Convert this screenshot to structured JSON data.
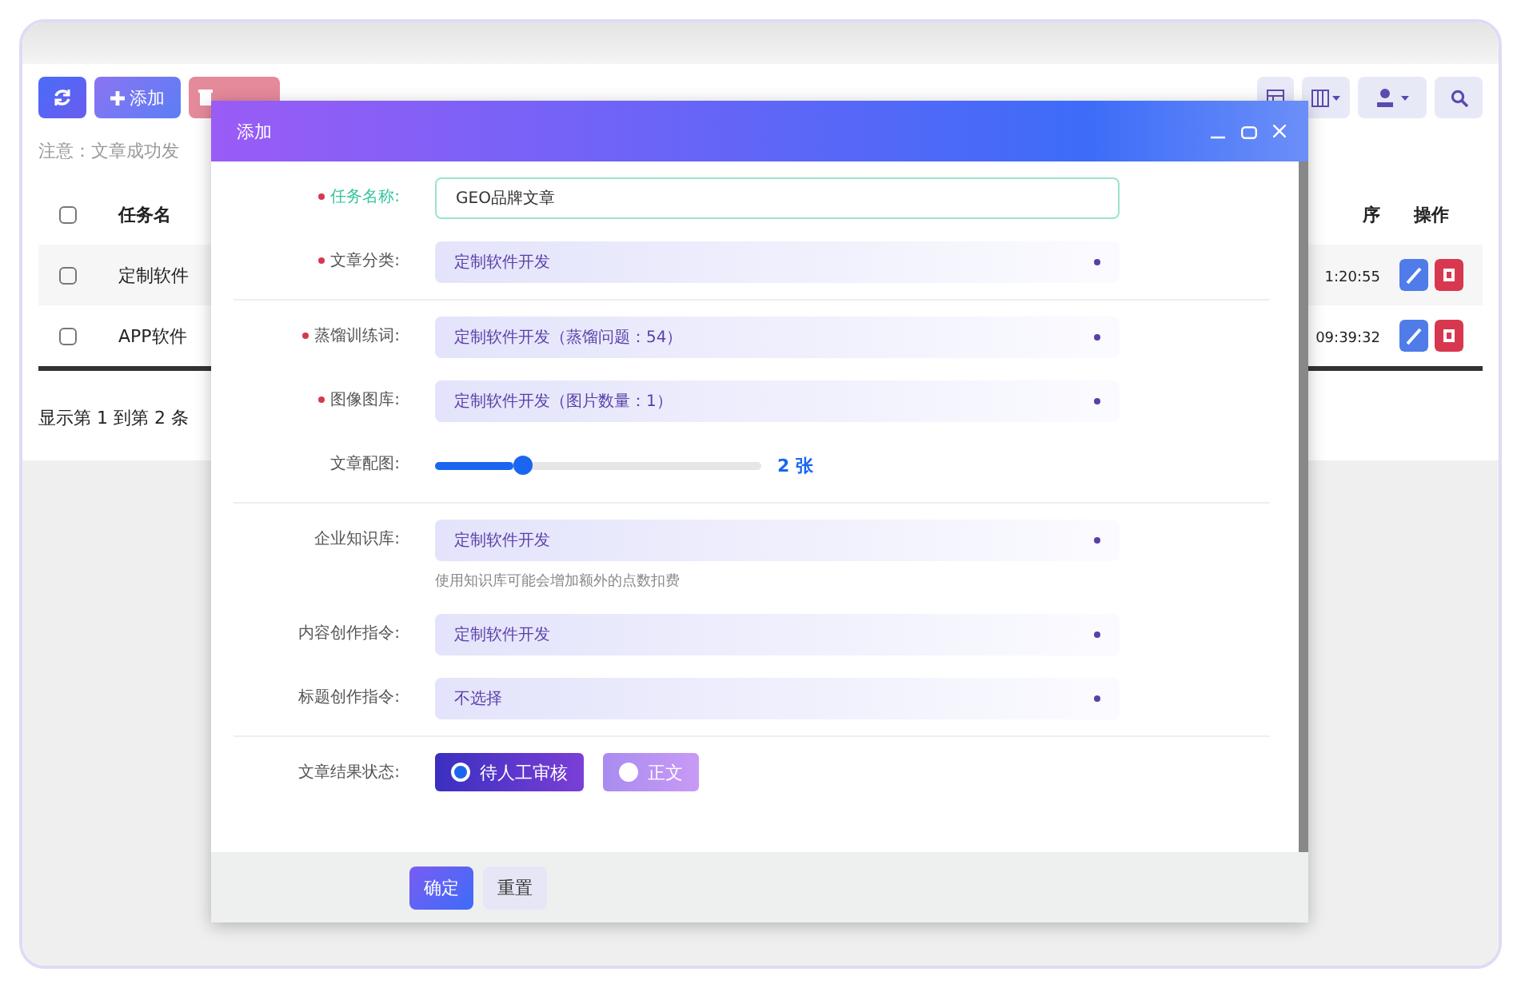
{
  "page": {
    "toolbar": {
      "add_label": "添加"
    },
    "note": "注意：文章成功发",
    "table": {
      "columns": [
        "任务名",
        "序",
        "操作"
      ],
      "header_checked": false,
      "rows": [
        {
          "name": "定制软件",
          "time": "1:20:55",
          "checked": false
        },
        {
          "name": "APP软件",
          "time": "09:39:32",
          "checked": false
        }
      ]
    },
    "footer": "显示第 1 到第 2 条"
  },
  "dialog": {
    "title": "添加",
    "groups": [
      [
        {
          "kind": "text",
          "label": "任务名称:",
          "required": true,
          "value": "GEO品牌文章"
        },
        {
          "kind": "select",
          "label": "文章分类:",
          "required": true,
          "value": "定制软件开发"
        }
      ],
      [
        {
          "kind": "select",
          "label": "蒸馏训练词:",
          "required": true,
          "value": "定制软件开发（蒸馏问题：54）"
        },
        {
          "kind": "select",
          "label": "图像图库:",
          "required": true,
          "value": "定制软件开发（图片数量：1）"
        },
        {
          "kind": "slider",
          "label": "文章配图:",
          "required": false,
          "level": 0.27,
          "reading": "2 张"
        }
      ],
      [
        {
          "kind": "select",
          "label": "企业知识库:",
          "required": false,
          "value": "定制软件开发",
          "hint": "使用知识库可能会增加额外的点数扣费"
        },
        {
          "kind": "select",
          "label": "内容创作指令:",
          "required": false,
          "value": "定制软件开发"
        },
        {
          "kind": "select",
          "label": "标题创作指令:",
          "required": false,
          "value": "不选择"
        }
      ],
      [
        {
          "kind": "radio",
          "label": "文章结果状态:",
          "required": false,
          "options": [
            {
              "label": "待人工审核",
              "selected": true
            },
            {
              "label": "正文",
              "selected": false
            }
          ]
        }
      ]
    ],
    "buttons": [
      {
        "label": "确定",
        "kind": "primary"
      },
      {
        "label": "重置",
        "kind": "plain"
      }
    ]
  }
}
